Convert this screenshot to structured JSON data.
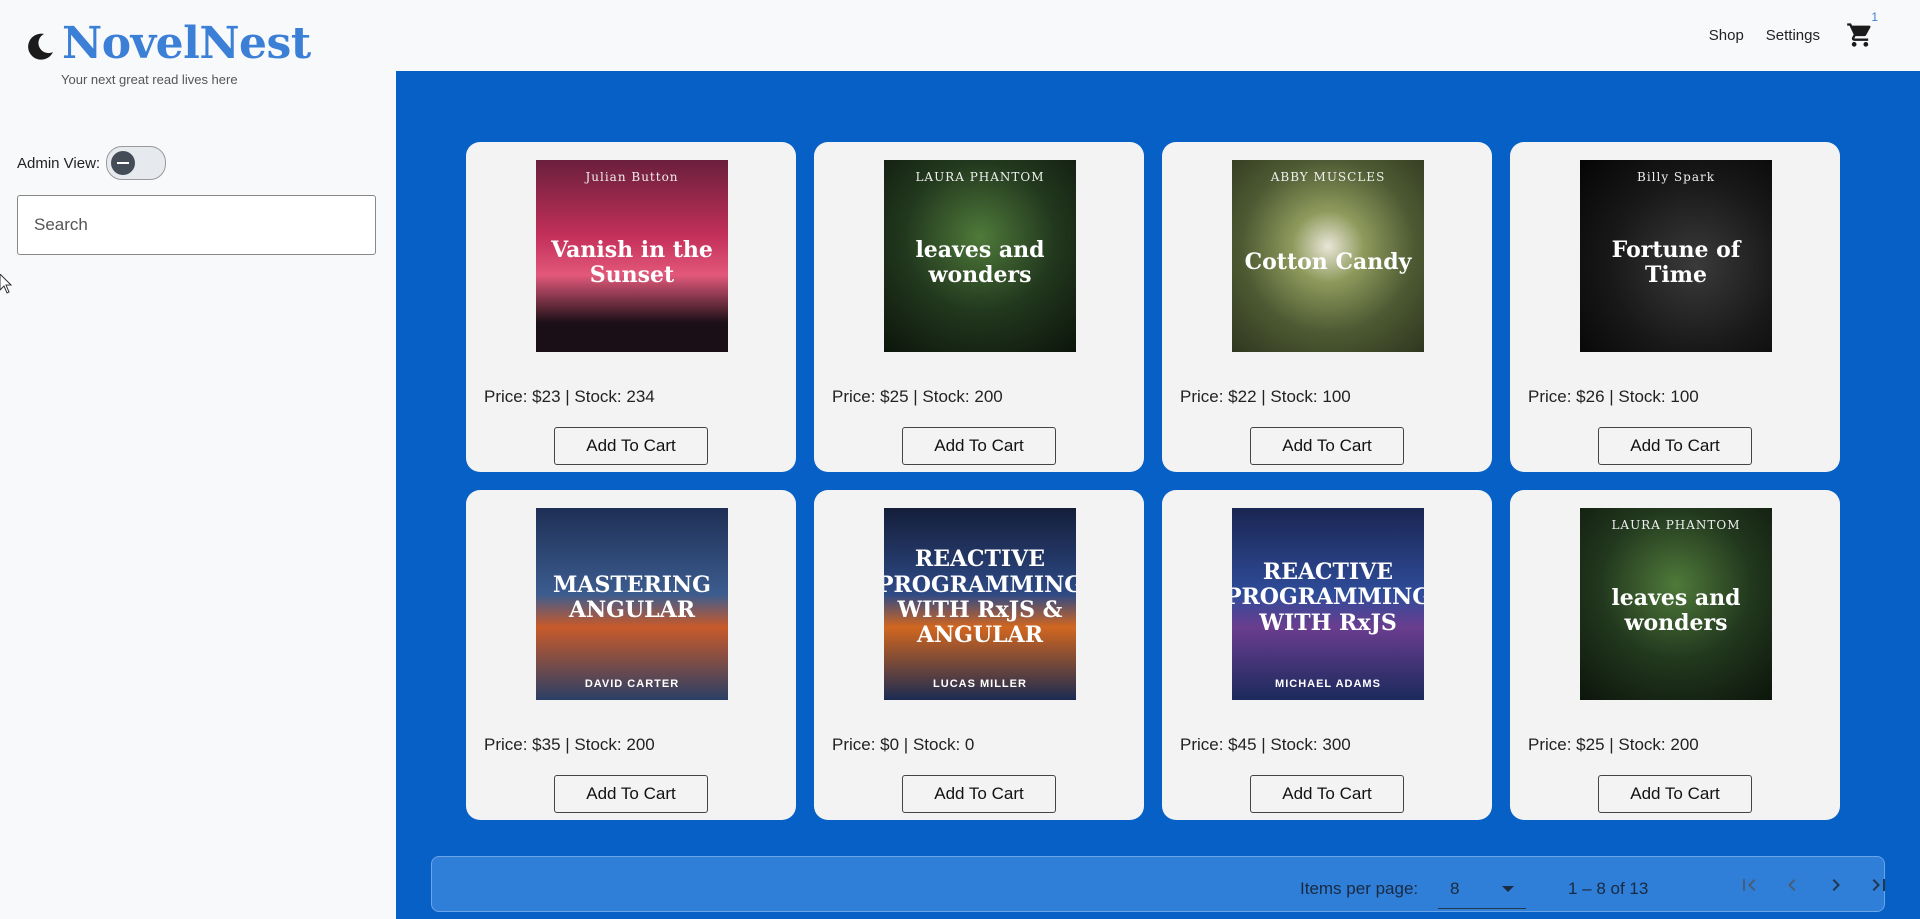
{
  "header": {
    "brand": "NovelNest",
    "tagline": "Your next great read lives here",
    "nav": [
      {
        "label": "Shop"
      },
      {
        "label": "Settings"
      }
    ],
    "cart_count": "1"
  },
  "sidebar": {
    "admin_label": "Admin View:",
    "admin_enabled": false,
    "search_placeholder": "Search"
  },
  "products": [
    {
      "author": "Julian Button",
      "cover_title": "Vanish in the Sunset",
      "cover_bottom": "",
      "info": "Price: $23 | Stock: 234",
      "button": "Add To Cart",
      "cover_bg": "linear-gradient(180deg,#6a1f3c 0%,#c4305a 40%,#e2587a 60%,#1a0f16 85%)"
    },
    {
      "author": "LAURA PHANTOM",
      "cover_title": "leaves and wonders",
      "cover_bottom": "",
      "info": "Price: $25 | Stock: 200",
      "button": "Add To Cart",
      "cover_bg": "radial-gradient(circle at 50% 40%,#4f7a3a 0%,#22381e 50%,#0c150b 100%)"
    },
    {
      "author": "ABBY MUSCLES",
      "cover_title": "Cotton Candy",
      "cover_bottom": "",
      "info": "Price: $22 | Stock: 100",
      "button": "Add To Cart",
      "cover_bg": "radial-gradient(circle at 50% 45%,#e9e6d8 0%,#8e9a5c 25%,#4e5a33 60%,#2f361f 100%)"
    },
    {
      "author": "Billy Spark",
      "cover_title": "Fortune of Time",
      "cover_bottom": "",
      "info": "Price: $26 | Stock: 100",
      "button": "Add To Cart",
      "cover_bg": "radial-gradient(circle at 60% 55%,#3a3a3a 0%,#181818 55%,#050505 100%)"
    },
    {
      "author": "",
      "cover_title": "MASTERING ANGULAR",
      "cover_bottom": "DAVID CARTER",
      "info": "Price: $35 | Stock: 200",
      "button": "Add To Cart",
      "cover_bg": "linear-gradient(180deg,#1e2f55 0%,#3c5c8f 45%,#c85a2a 62%,#2a3f66 100%)"
    },
    {
      "author": "",
      "cover_title": "REACTIVE PROGRAMMING WITH RxJS & ANGULAR",
      "cover_bottom": "LUCAS MILLER",
      "info": "Price: $0 | Stock: 0",
      "button": "Add To Cart",
      "cover_bg": "linear-gradient(180deg,#141e3a 0%,#2e4a86 45%,#d1661f 62%,#1b2b52 100%)"
    },
    {
      "author": "",
      "cover_title": "REACTIVE PROGRAMMING WITH RxJS",
      "cover_bottom": "MICHAEL ADAMS",
      "info": "Price: $45 | Stock: 300",
      "button": "Add To Cart",
      "cover_bg": "linear-gradient(180deg,#1a2652 0%,#2f4c9a 45%,#6a3d8f 62%,#1b2a5c 100%)"
    },
    {
      "author": "LAURA PHANTOM",
      "cover_title": "leaves and wonders",
      "cover_bottom": "",
      "info": "Price: $25 | Stock: 200",
      "button": "Add To Cart",
      "cover_bg": "radial-gradient(circle at 50% 40%,#4f7a3a 0%,#22381e 50%,#0c150b 100%)"
    }
  ],
  "paginator": {
    "items_per_page_label": "Items per page:",
    "page_size": "8",
    "range_label": "1 – 8 of 13"
  },
  "colors": {
    "brand": "#3b7fd6",
    "main_bg": "#0660c5",
    "paginator_bg": "#2f7ed8"
  }
}
